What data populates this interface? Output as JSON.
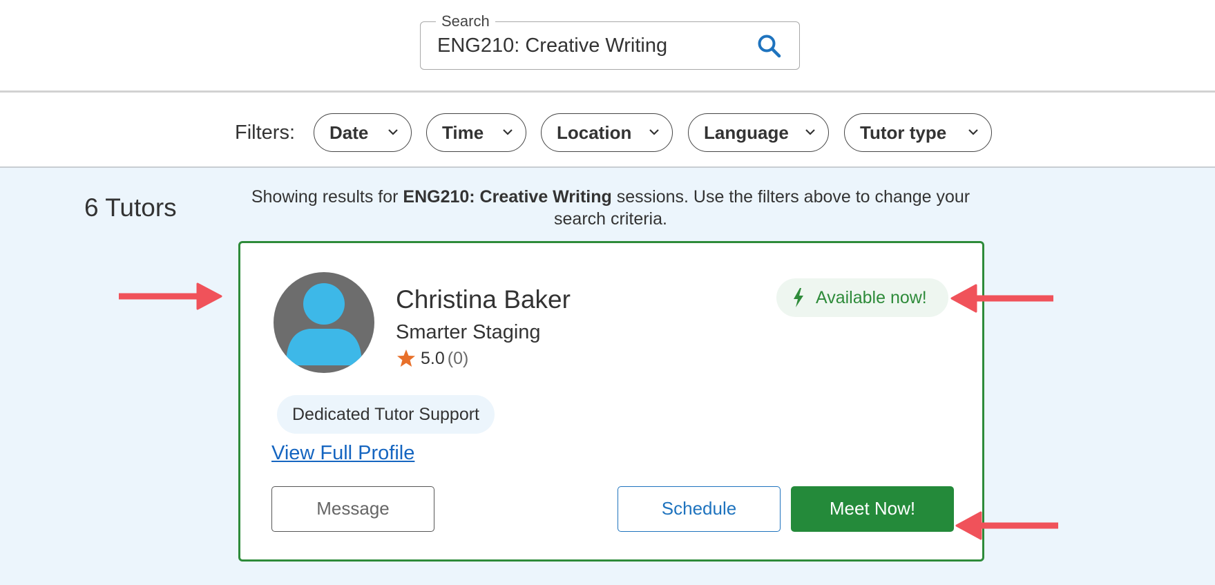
{
  "search": {
    "legend": "Search",
    "value": "ENG210: Creative Writing",
    "icon": "search-icon"
  },
  "filters": {
    "label": "Filters:",
    "chips": [
      "Date",
      "Time",
      "Location",
      "Language",
      "Tutor type"
    ]
  },
  "results": {
    "count_text": "6 Tutors",
    "summary_prefix": "Showing results for ",
    "summary_bold": "ENG210: Creative Writing",
    "summary_suffix": " sessions. Use the filters above to change your search criteria."
  },
  "tutor": {
    "name": "Christina Baker",
    "org": "Smarter Staging",
    "rating": "5.0",
    "rating_count": "(0)",
    "availability": "Available now!",
    "tag": "Dedicated Tutor Support",
    "profile_link": "View Full Profile",
    "buttons": {
      "message": "Message",
      "schedule": "Schedule",
      "meet": "Meet Now!"
    }
  },
  "colors": {
    "accent_green": "#2e8b3a",
    "accent_blue": "#1e73be",
    "results_bg": "#ecf5fc",
    "annotation_red": "#f0525a",
    "star": "#e8702a",
    "avatar_fill": "#3db8e8"
  }
}
